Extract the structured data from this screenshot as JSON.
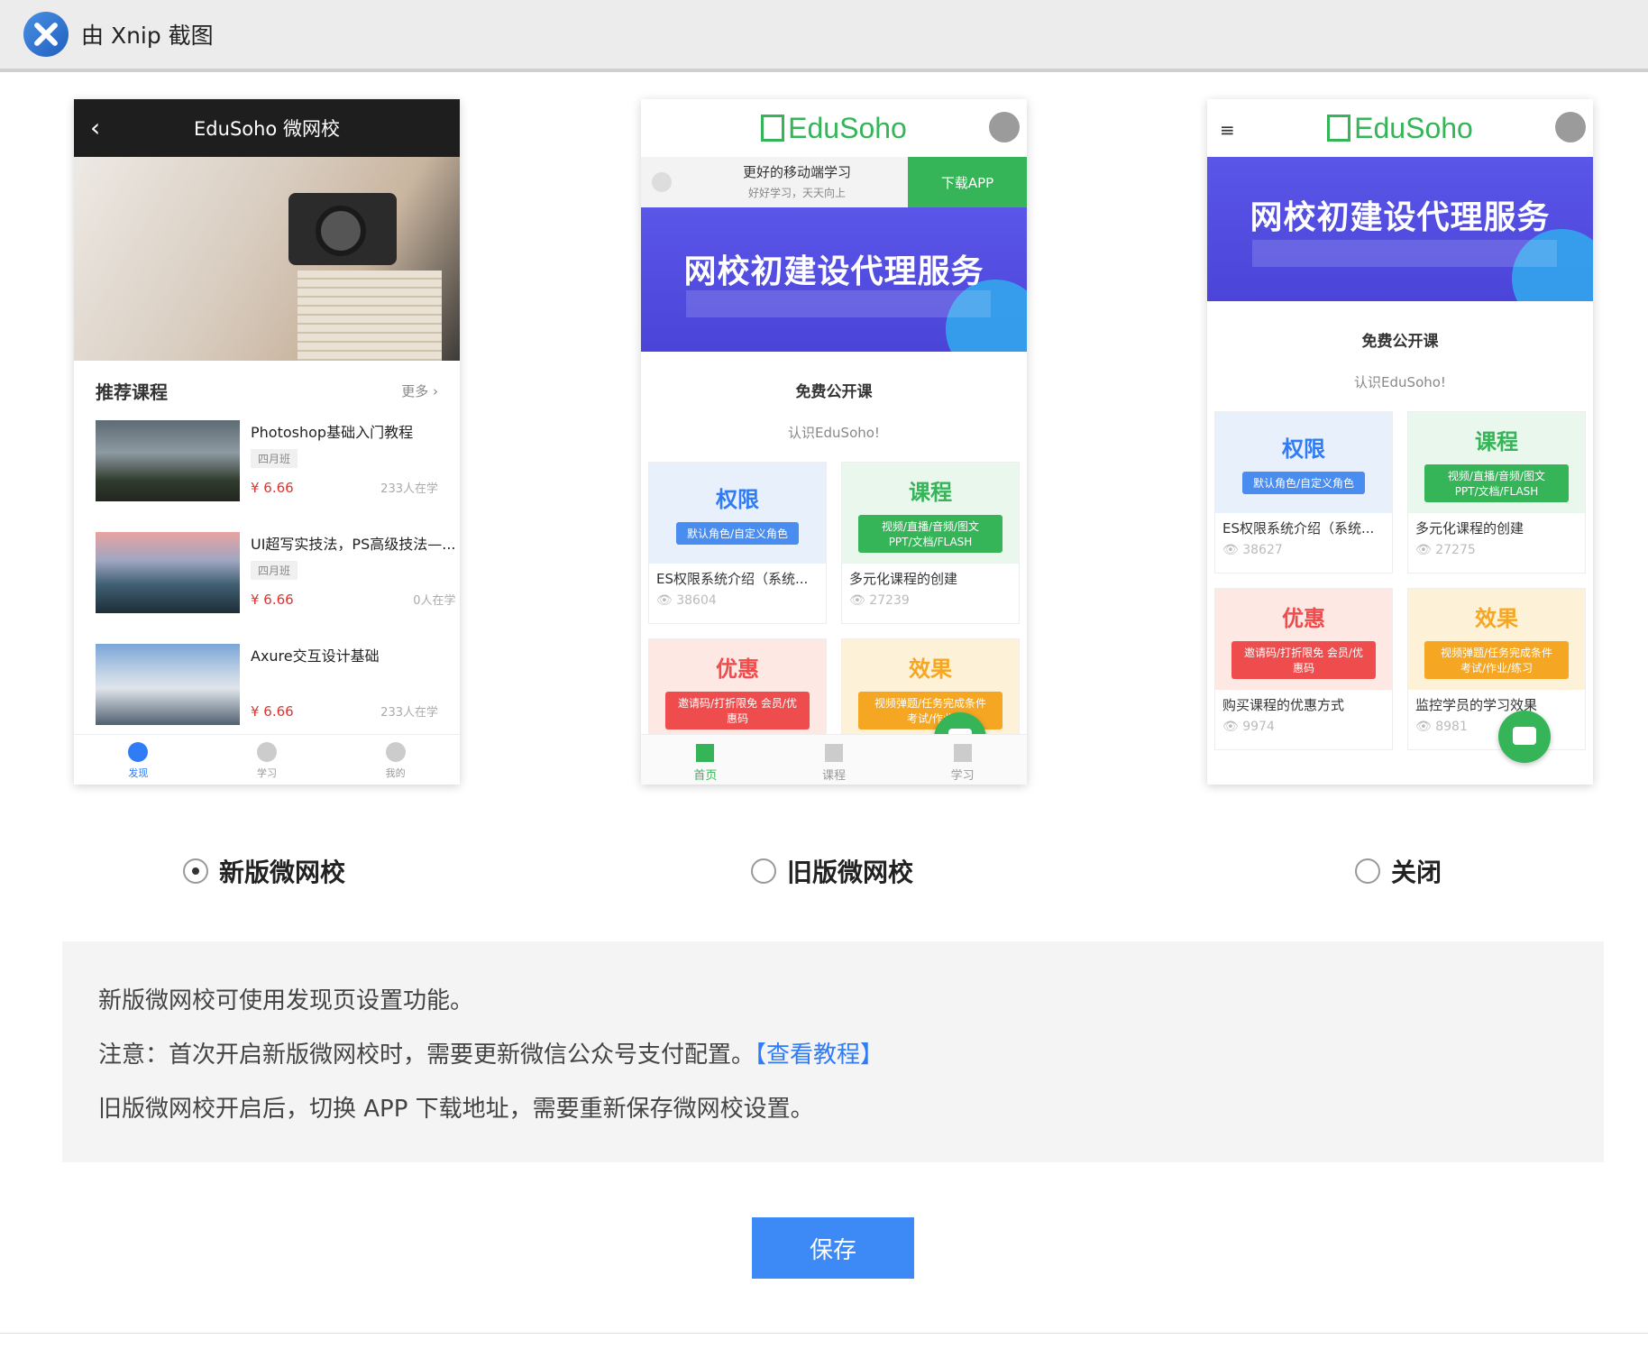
{
  "xnip": {
    "title": "由 Xnip 截图"
  },
  "preview_new": {
    "header_title": "EduSoho 微网校",
    "section_title": "推荐课程",
    "section_more": "更多 ›",
    "courses": [
      {
        "title": "Photoshop基础入门教程",
        "tag": "四月班",
        "price": "¥ 6.66",
        "students": "233人在学"
      },
      {
        "title": "UI超写实技法，PS高级技法—...",
        "tag": "四月班",
        "price": "¥ 6.66",
        "students": "0人在学"
      },
      {
        "title": "Axure交互设计基础",
        "tag": "",
        "price": "¥ 6.66",
        "students": "233人在学"
      }
    ],
    "tabs": [
      "发现",
      "学习",
      "我的"
    ]
  },
  "preview_old": {
    "brand": "EduSoho",
    "download_text": "更好的移动端学习",
    "download_sub": "好好学习，天天向上",
    "download_btn": "下载APP",
    "banner_title": "网校初建设代理服务",
    "public_title": "免费公开课",
    "public_sub": "认识EduSoho!",
    "cards": [
      {
        "feature": "权限",
        "badge": "默认角色/自定义角色",
        "title": "ES权限系统介绍（系统...",
        "views": "38604"
      },
      {
        "feature": "课程",
        "badge": "视频/直播/音频/图文 PPT/文档/FLASH",
        "title": "多元化课程的创建",
        "views": "27239"
      },
      {
        "feature": "优惠",
        "badge": "邀请码/打折限免 会员/优惠码",
        "title": "",
        "views": ""
      },
      {
        "feature": "效果",
        "badge": "视频弹题/任务完成条件 考试/作业",
        "title": "",
        "views": ""
      }
    ],
    "tabs": [
      "首页",
      "课程",
      "学习"
    ]
  },
  "preview_closed": {
    "brand": "EduSoho",
    "banner_title": "网校初建设代理服务",
    "public_title": "免费公开课",
    "public_sub": "认识EduSoho!",
    "cards": [
      {
        "feature": "权限",
        "badge": "默认角色/自定义角色",
        "title": "ES权限系统介绍（系统...",
        "views": "38627"
      },
      {
        "feature": "课程",
        "badge": "视频/直播/音频/图文 PPT/文档/FLASH",
        "title": "多元化课程的创建",
        "views": "27275"
      },
      {
        "feature": "优惠",
        "badge": "邀请码/打折限免 会员/优惠码",
        "title": "购买课程的优惠方式",
        "views": "9974"
      },
      {
        "feature": "效果",
        "badge": "视频弹题/任务完成条件 考试/作业/练习",
        "title": "监控学员的学习效果",
        "views": "8981"
      }
    ]
  },
  "options": {
    "new_label": "新版微网校",
    "old_label": "旧版微网校",
    "close_label": "关闭",
    "selected": "new"
  },
  "notes": {
    "line1": "新版微网校可使用发现页设置功能。",
    "line2": "注意：首次开启新版微网校时，需要更新微信公众号支付配置。",
    "line2_link": "【查看教程】",
    "line3": "旧版微网校开启后，切换 APP 下载地址，需要重新保存微网校设置。"
  },
  "save_label": "保存",
  "colors": {
    "brand_green": "#35b558",
    "primary_blue": "#3d8af7",
    "link_blue": "#2f7cf6"
  }
}
